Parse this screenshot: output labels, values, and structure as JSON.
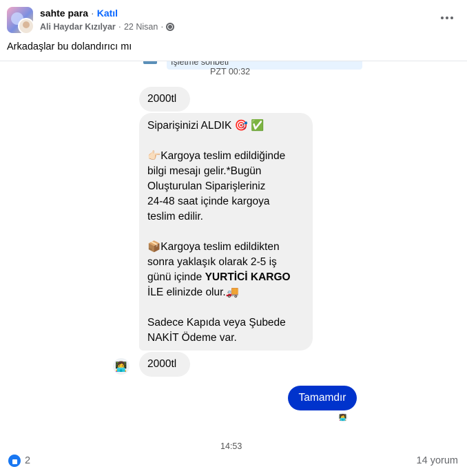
{
  "post": {
    "group_name": "sahte para",
    "separator": "·",
    "join_label": "Katıl",
    "author": "Ali Haydar Kızılyar",
    "date": "22 Nisan",
    "caption": "Arkadaşlar bu dolandırıcı mı"
  },
  "screenshot": {
    "cut_card_text": "İşletme sohbeti",
    "cut_time": "PZT 00:32",
    "messages": {
      "first": "2000tl",
      "order_lines": [
        "Siparişinizi ALDIK 🎯 ✅",
        "👉🏻Kargoya teslim edildiğinde",
        "bilgi mesajı gelir.*Bugün",
        "Oluşturulan Siparişleriniz",
        "24-48 saat içinde kargoya",
        "teslim edilir.",
        "📦Kargoya teslim edildikten",
        "sonra yaklaşık olarak 2-5 iş",
        "günü içinde ",
        "YURTİCİ KARGO",
        "İLE elinizde olur.🚚",
        "Sadece Kapıda veya Şubede",
        "NAKİT Ödeme var."
      ],
      "second": "2000tl",
      "reply": "Tamamdır"
    },
    "sender_avatar_emoji": "👩‍💻",
    "seen_avatar_emoji": "👩‍💻",
    "timestamp": "14:53"
  },
  "footer": {
    "like_count": "2",
    "comments_label": "14 yorum"
  },
  "colors": {
    "link": "#0866ff",
    "reply_bubble": "#0033cc",
    "incoming_bubble": "#f0f0f0",
    "like": "#1877f2"
  },
  "icons": [
    "group-avatar",
    "user-avatar",
    "globe-icon",
    "more-options-icon",
    "like-reaction-icon"
  ]
}
